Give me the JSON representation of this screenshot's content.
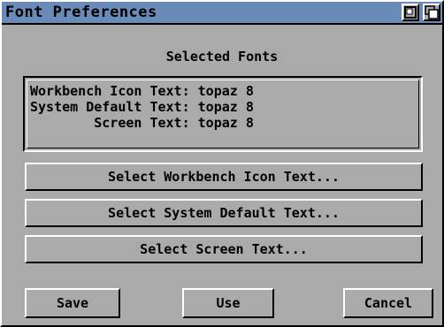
{
  "window": {
    "title": "Font Preferences"
  },
  "selected": {
    "heading": "Selected Fonts",
    "lines": [
      "Workbench Icon Text: topaz 8",
      "System Default Text: topaz 8",
      "        Screen Text: topaz 8"
    ]
  },
  "actions": {
    "select_workbench": "Select Workbench Icon Text...",
    "select_system": "Select System Default Text...",
    "select_screen": "Select Screen Text..."
  },
  "footer": {
    "save": "Save",
    "use": "Use",
    "cancel": "Cancel"
  },
  "colors": {
    "titlebar": "#6a8ab8",
    "panel": "#aaaaaa",
    "highlight": "#ffffff",
    "shadow": "#000000"
  },
  "icons": {
    "zoom_gadget": "zoom-icon",
    "depth_gadget": "depth-icon"
  }
}
